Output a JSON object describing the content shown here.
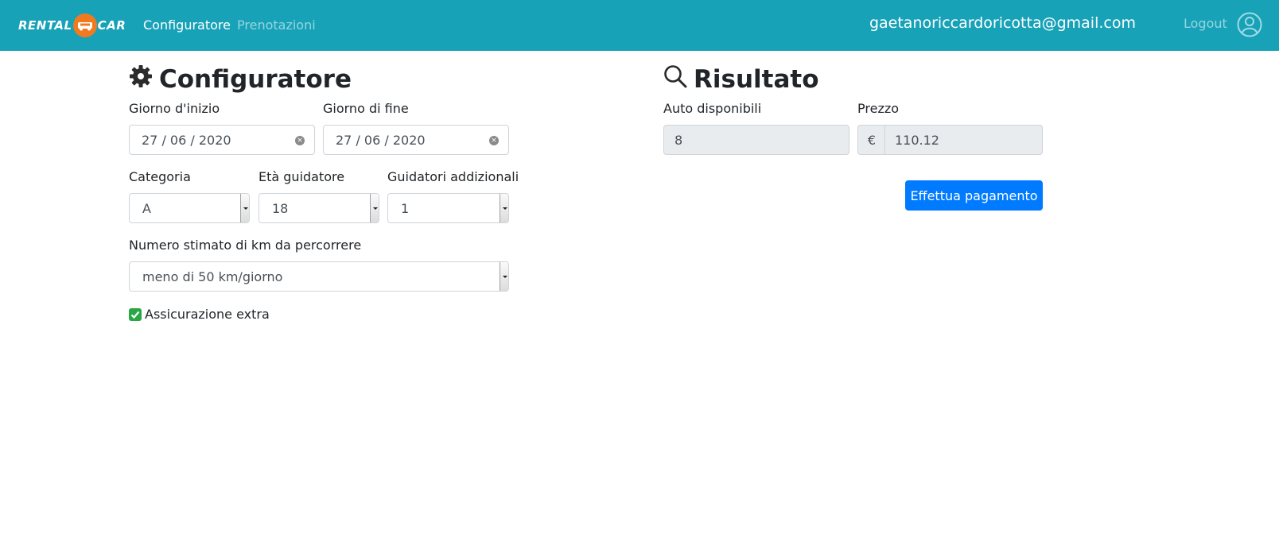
{
  "navbar": {
    "brand_left": "RENTAL",
    "brand_right": "CAR",
    "links": [
      {
        "label": "Configuratore",
        "active": true
      },
      {
        "label": "Prenotazioni",
        "active": false
      }
    ],
    "user_email": "gaetanoriccardoricotta@gmail.com",
    "logout_label": "Logout",
    "accent_color": "#17a2b8",
    "brand_badge_color": "#f07a1f"
  },
  "configurator": {
    "title": "Configuratore",
    "icon": "gear-icon",
    "start_date": {
      "label": "Giorno d'inizio",
      "day": "27",
      "month": "06",
      "year": "2020"
    },
    "end_date": {
      "label": "Giorno di fine",
      "day": "27",
      "month": "06",
      "year": "2020"
    },
    "category": {
      "label": "Categoria",
      "value": "A"
    },
    "driver_age": {
      "label": "Età guidatore",
      "value": "18"
    },
    "additional_drivers": {
      "label": "Guidatori addizionali",
      "value": "1"
    },
    "km_estimate": {
      "label": "Numero stimato di km da percorrere",
      "value": "meno di 50 km/giorno"
    },
    "extra_insurance": {
      "label": "Assicurazione extra",
      "checked": true
    }
  },
  "result": {
    "title": "Risultato",
    "icon": "search-icon",
    "available_cars": {
      "label": "Auto disponibili",
      "value": "8"
    },
    "price": {
      "label": "Prezzo",
      "currency": "€",
      "value": "110.12"
    },
    "pay_button_label": "Effettua pagamento",
    "button_color": "#007bff"
  }
}
